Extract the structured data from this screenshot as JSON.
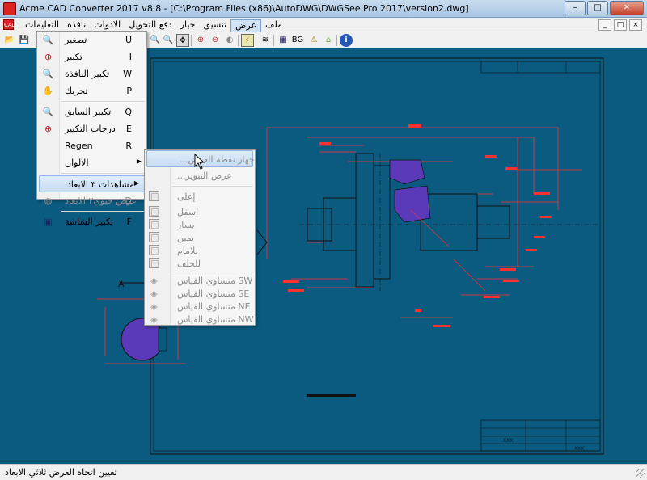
{
  "window": {
    "title": "Acme CAD Converter 2017 v8.8 - [C:\\Program Files (x86)\\AutoDWG\\DWGSee Pro 2017\\version2.dwg]",
    "minimize": "–",
    "maximize": "□",
    "close": "✕"
  },
  "menubar": {
    "items": [
      "ملف",
      "عرض",
      "تنسيق",
      "خيار",
      "دفع التحويل",
      "الادوات",
      "نافذة",
      "التعليمات"
    ],
    "active": "عرض",
    "mdi": [
      "_",
      "□",
      "×"
    ]
  },
  "toolbar": {
    "bg_label": "BG"
  },
  "view_menu": {
    "items": [
      {
        "label": "تصغير",
        "key": "U",
        "icon": "zoom-out-icon"
      },
      {
        "label": "تكبير",
        "key": "I",
        "icon": "zoom-in-icon"
      },
      {
        "label": "تكبير النافذة",
        "key": "W",
        "icon": "zoom-window-icon"
      },
      {
        "label": "تحريك",
        "key": "P",
        "icon": "pan-icon"
      },
      {
        "label": "تكبير السابق",
        "key": "Q",
        "icon": "zoom-previous-icon"
      },
      {
        "label": "درجات التكبير",
        "key": "E",
        "icon": "zoom-extents-icon"
      },
      {
        "label": "Regen",
        "key": "R",
        "icon": ""
      },
      {
        "label": "الالوان",
        "key": "",
        "icon": ""
      },
      {
        "label": "مشاهدات ٣ الابعاد",
        "key": "",
        "icon": ""
      },
      {
        "label": "عرض حيوي٣ الابعاد",
        "key": "D",
        "icon": "orbit-icon"
      },
      {
        "label": "تكبير الشاشة",
        "key": "F",
        "icon": "fullscreen-icon"
      }
    ]
  },
  "submenu_3d": {
    "items": [
      {
        "label": "...جهاز نقطة العرض"
      },
      {
        "label": "...عرض التبويز"
      },
      {
        "label": "إعلى"
      },
      {
        "label": "إسفل"
      },
      {
        "label": "يسار"
      },
      {
        "label": "يمين"
      },
      {
        "label": "للامام"
      },
      {
        "label": "للخلف"
      },
      {
        "label": "متساوي القياس SW"
      },
      {
        "label": "متساوي القياس SE"
      },
      {
        "label": "متساوي القياس NE"
      },
      {
        "label": "متساوي القياس NW"
      }
    ]
  },
  "drawing": {
    "section_label": "A",
    "title_block_text": "XXX"
  },
  "status": {
    "text": "تعيين اتجاه العرض ثلاثي الابعاد"
  },
  "colors": {
    "canvas": "#0b5b80",
    "drawing_red": "#ff3030",
    "drawing_black": "#111111",
    "hatch_purple": "#5a3ab8"
  }
}
